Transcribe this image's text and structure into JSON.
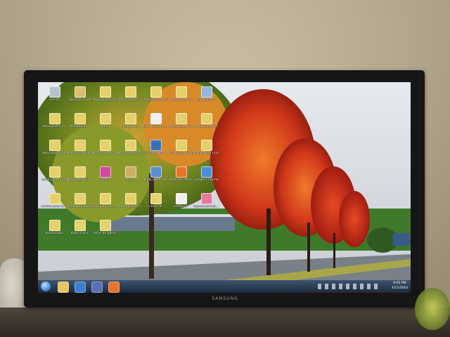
{
  "monitor": {
    "brand": "SAMSUNG"
  },
  "desktop_icons": [
    {
      "label": "Lixeira",
      "color": "#b8c2cc"
    },
    {
      "label": "Apostila 2014",
      "color": "#d8c070"
    },
    {
      "label": "Nova pasta (2)",
      "color": "#e5d06a"
    },
    {
      "label": "Nova pasta (3)",
      "color": "#e5d06a"
    },
    {
      "label": "Nova pasta (4)",
      "color": "#e5d06a"
    },
    {
      "label": "Nova pasta (5)",
      "color": "#e5d06a"
    },
    {
      "label": "Computador",
      "color": "#8fb6dc"
    },
    {
      "label": "Nova pasta (6)",
      "color": "#e5d06a"
    },
    {
      "label": "documentos",
      "color": "#e5d06a"
    },
    {
      "label": "fotos",
      "color": "#e5d06a"
    },
    {
      "label": "trabalhos",
      "color": "#e5d06a"
    },
    {
      "label": "Novo Documento",
      "color": "#f0f0f0"
    },
    {
      "label": "Nova pasta (7)",
      "color": "#e5d06a"
    },
    {
      "label": "Nova pasta (8)",
      "color": "#e5d06a"
    },
    {
      "label": "Nova pasta (9)",
      "color": "#e5d06a"
    },
    {
      "label": "Nova pasta (10)",
      "color": "#e5d06a"
    },
    {
      "label": "Nova pasta (11)",
      "color": "#e5d06a"
    },
    {
      "label": "Nova pasta (12)",
      "color": "#e5d06a"
    },
    {
      "label": "Chipps_WMF",
      "color": "#3a70b8"
    },
    {
      "label": "Nova pasta (13)",
      "color": "#e5d06a"
    },
    {
      "label": "Nova pasta (14)",
      "color": "#e5d06a"
    },
    {
      "label": "Nova pasta (15)",
      "color": "#e5d06a"
    },
    {
      "label": "Nova pasta (16)",
      "color": "#e5d06a"
    },
    {
      "label": "Picasa",
      "color": "#d04aa0"
    },
    {
      "label": "p.zip",
      "color": "#c8b060"
    },
    {
      "label": "WBN_84PA.exe",
      "color": "#5a8ed0"
    },
    {
      "label": "Mozilla Firefox",
      "color": "#e8742a"
    },
    {
      "label": "Google Chrome",
      "color": "#4a90d8"
    },
    {
      "label": "crochê para fazer",
      "color": "#e5d06a"
    },
    {
      "label": "ponto tunisiano",
      "color": "#e5d06a"
    },
    {
      "label": "22625385_1084...",
      "color": "#e5d06a"
    },
    {
      "label": "Nova pasta (7)",
      "color": "#e5d06a"
    },
    {
      "label": "CROCHE",
      "color": "#e5d06a"
    },
    {
      "label": "Zerotops",
      "color": "#f0f0f0"
    },
    {
      "label": "bigstockphoto...",
      "color": "#e87aa0"
    },
    {
      "label": "Nova pasta",
      "color": "#e5d06a"
    },
    {
      "label": "fotos e pns",
      "color": "#e5d06a"
    },
    {
      "label": "fotos de gatos",
      "color": "#e5d06a"
    }
  ],
  "taskbar": {
    "start_color": "#4a8fd4",
    "pinned": [
      {
        "name": "explorer",
        "color": "#e5c560"
      },
      {
        "name": "media",
        "color": "#3d7ed0"
      },
      {
        "name": "program",
        "color": "#5b6fb4"
      },
      {
        "name": "firefox",
        "color": "#e8742a"
      }
    ],
    "clock_time": "9:05 PM",
    "clock_date": "4/15/2016"
  }
}
